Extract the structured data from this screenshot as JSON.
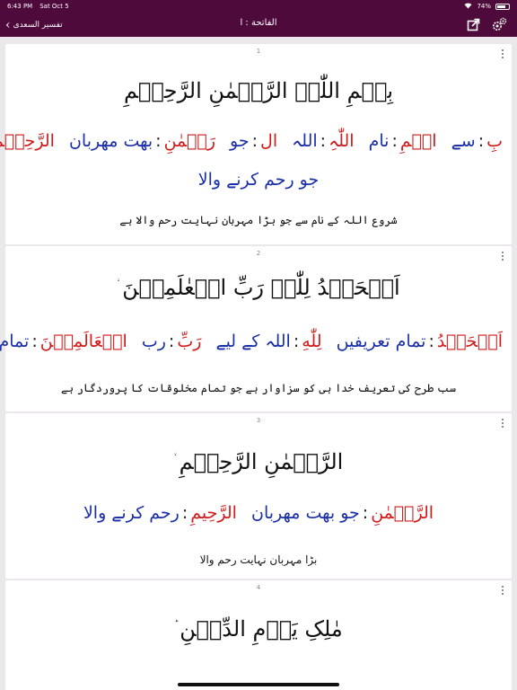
{
  "status": {
    "time": "6:43 PM",
    "date": "Sat Oct 5",
    "battery": "74%",
    "battery_level": 0.74
  },
  "nav": {
    "back_label": "تفسیر السعدی",
    "title": "الفاتحة : ا"
  },
  "colors": {
    "bar": "#4d0a3b",
    "arabic_word": "#d11a1a",
    "urdu_word": "#1a2fa8"
  },
  "verses": [
    {
      "number": "1",
      "arabic": "بِسۡمِ اللّٰہِ الرَّحۡمٰنِ الرَّحِیۡمِ",
      "end_mark": "",
      "words": [
        {
          "ar": "بِ",
          "ur": "سے"
        },
        {
          "ar": "اسۡمِ",
          "ur": "نام"
        },
        {
          "ar": "اللّٰہِ",
          "ur": "اللہ"
        },
        {
          "ar": "ال",
          "ur": "جو"
        },
        {
          "ar": "رَحۡمٰنِ",
          "ur": "بهت مهربان"
        },
        {
          "ar": "الرَّحِیۡمِ",
          "ur": ""
        }
      ],
      "words_line2": "جو رحم کرنے والا",
      "translation": "شروع اللہ کے نام سے جو بڑا مہربان نہایت رحم والا ہے"
    },
    {
      "number": "2",
      "arabic": "اَلۡحَمۡدُ لِلّٰہِ رَبِّ الۡعٰلَمِیۡنَ",
      "end_mark": "ۙ",
      "words": [
        {
          "ar": "اَلۡحَمۡدُ",
          "ur": "تمام تعریفیں"
        },
        {
          "ar": "لِلّٰهِ",
          "ur": "اللہ کے لیے"
        },
        {
          "ar": "رَبِّ",
          "ur": "رب"
        },
        {
          "ar": "الۡعَالَمِيۡنَ",
          "ur": "تمام جهان"
        }
      ],
      "translation": "سب طرح کی تعریف خدا ہی کو سزاوار ہے جو تمام مخلوقات کا پروردگار ہے"
    },
    {
      "number": "3",
      "arabic": "الرَّحۡمٰنِ الرَّحِیۡمِ",
      "end_mark": "ۙ",
      "words": [
        {
          "ar": "الرَّحۡمٰنِ",
          "ur": "جو بهت مهربان"
        },
        {
          "ar": "الرَّحِيمِ",
          "ur": "رحم کرنے والا"
        }
      ],
      "translation": "بڑا مہربان نہایت رحم والا"
    },
    {
      "number": "4",
      "arabic": "مٰلِکِ یَوۡمِ الدِّیۡنِ",
      "end_mark": "ؕ"
    }
  ]
}
